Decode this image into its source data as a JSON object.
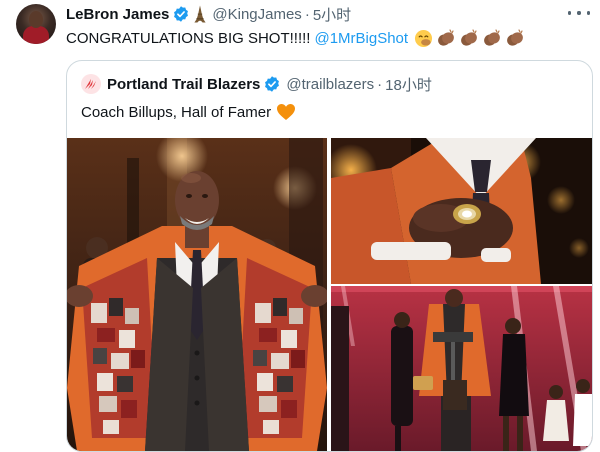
{
  "tweet": {
    "author_name": "LeBron James",
    "author_handle": "@KingJames",
    "separator": "·",
    "time": "5小时",
    "text": "CONGRATULATIONS BIG SHOT!!!!!",
    "mention": "@1MrBigShot",
    "emojis": [
      "slightly-smiling-face-with-hand-over-mouth",
      "clapping-hands-dark",
      "clapping-hands-dark",
      "clapping-hands-dark",
      "clapping-hands-dark"
    ]
  },
  "quote": {
    "author_name": "Portland Trail Blazers",
    "author_handle": "@trailblazers",
    "separator": "·",
    "time": "18小时",
    "text": "Coach Billups, Hall of Famer",
    "heart_emoji": "orange-heart",
    "photos": [
      {
        "subject": "man-showing-jacket-lining"
      },
      {
        "subject": "ring-on-hand"
      },
      {
        "subject": "stage-family"
      }
    ]
  },
  "colors": {
    "verified_blue": "#1d9bf0",
    "link_blue": "#1d9bf0",
    "secondary_text": "#536471",
    "border": "#cfd9de",
    "blazers_red": "#e03a3e",
    "orange_heart": "#f4900c"
  }
}
